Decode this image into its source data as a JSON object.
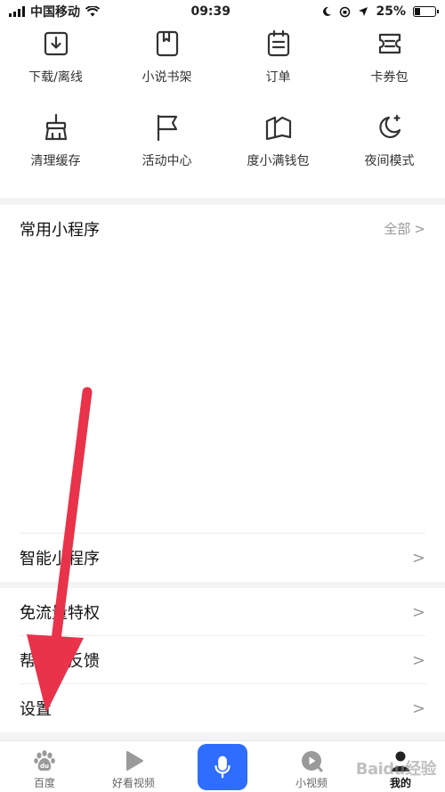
{
  "status_bar": {
    "carrier": "中国移动",
    "time": "09:39",
    "battery": "25%"
  },
  "grid": [
    {
      "label": "下载/离线",
      "icon": "download-icon"
    },
    {
      "label": "小说书架",
      "icon": "bookmark-book-icon"
    },
    {
      "label": "订单",
      "icon": "order-list-icon"
    },
    {
      "label": "卡券包",
      "icon": "coupon-icon"
    },
    {
      "label": "清理缓存",
      "icon": "broom-icon"
    },
    {
      "label": "活动中心",
      "icon": "flag-icon"
    },
    {
      "label": "度小满钱包",
      "icon": "wallet-icon"
    },
    {
      "label": "夜间模式",
      "icon": "moon-icon"
    }
  ],
  "mini_programs": {
    "title": "常用小程序",
    "all_label": "全部",
    "chevron": ">"
  },
  "rows": [
    {
      "label": "智能小程序",
      "chevron": ">"
    },
    {
      "label": "免流量特权",
      "chevron": ">"
    },
    {
      "label": "帮助与反馈",
      "chevron": ">"
    },
    {
      "label": "设置",
      "chevron": ">"
    }
  ],
  "tabbar": {
    "tabs": [
      {
        "label": "百度",
        "icon": "baidu-paw-icon"
      },
      {
        "label": "好看视频",
        "icon": "play-icon"
      },
      {
        "label": "",
        "icon": "microphone-icon"
      },
      {
        "label": "小视频",
        "icon": "small-video-icon"
      },
      {
        "label": "我的",
        "icon": "user-icon"
      }
    ]
  },
  "watermark": "Baidu经验",
  "colors": {
    "accent": "#2f6dff",
    "arrow": "#e8334a",
    "band": "#f4f4f6"
  }
}
